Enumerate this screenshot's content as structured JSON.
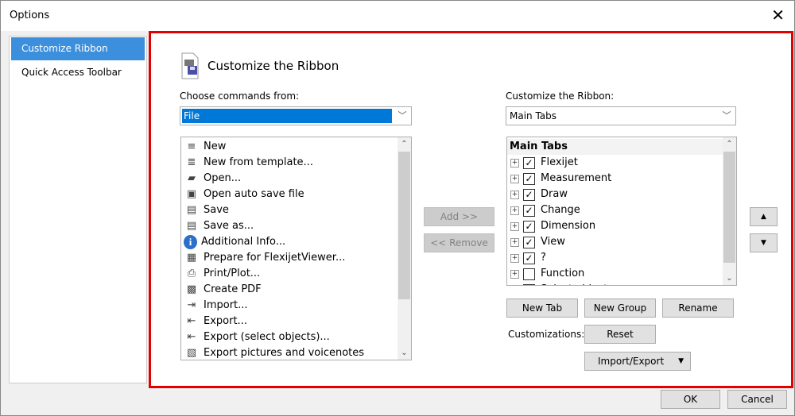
{
  "window": {
    "title": "Options",
    "close": "✕"
  },
  "sidebar": {
    "items": [
      {
        "label": "Customize Ribbon",
        "selected": true
      },
      {
        "label": "Quick Access Toolbar",
        "selected": false
      }
    ]
  },
  "header": {
    "title": "Customize the Ribbon"
  },
  "left": {
    "label": "Choose commands from:",
    "combo": "File",
    "commands": [
      {
        "label": "New",
        "icon": "≡"
      },
      {
        "label": "New from template...",
        "icon": "≣"
      },
      {
        "label": "Open...",
        "icon": "▰"
      },
      {
        "label": "Open auto save file",
        "icon": "▣"
      },
      {
        "label": "Save",
        "icon": "▤"
      },
      {
        "label": "Save as...",
        "icon": "▤"
      },
      {
        "label": "Additional Info...",
        "icon": "i"
      },
      {
        "label": "Prepare for FlexijetViewer...",
        "icon": "▦"
      },
      {
        "label": "Print/Plot...",
        "icon": "⎙"
      },
      {
        "label": "Create PDF",
        "icon": "▩"
      },
      {
        "label": "Import...",
        "icon": "⇥"
      },
      {
        "label": "Export...",
        "icon": "⇤"
      },
      {
        "label": "Export (select objects)...",
        "icon": "⇤"
      },
      {
        "label": "Export pictures and voicenotes",
        "icon": "▧"
      }
    ]
  },
  "middle": {
    "add": "Add >>",
    "remove": "<< Remove"
  },
  "right": {
    "label": "Customize the Ribbon:",
    "combo": "Main Tabs",
    "header": "Main Tabs",
    "tabs": [
      {
        "label": "Flexijet",
        "checked": true
      },
      {
        "label": "Measurement",
        "checked": true
      },
      {
        "label": "Draw",
        "checked": true
      },
      {
        "label": "Change",
        "checked": true
      },
      {
        "label": "Dimension",
        "checked": true
      },
      {
        "label": "View",
        "checked": true
      },
      {
        "label": "?",
        "checked": true
      },
      {
        "label": "Function",
        "checked": false
      },
      {
        "label": "Select objects",
        "checked": false
      }
    ]
  },
  "buttons": {
    "new_tab": "New Tab",
    "new_group": "New Group",
    "rename": "Rename",
    "customizations": "Customizations:",
    "reset": "Reset",
    "import_export": "Import/Export",
    "ok": "OK",
    "cancel": "Cancel",
    "move_up": "▲",
    "move_down": "▼"
  }
}
